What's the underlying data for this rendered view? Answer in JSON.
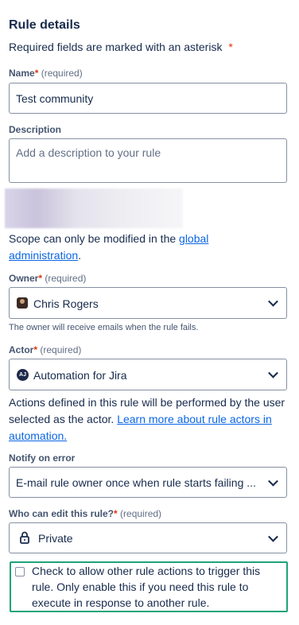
{
  "section": {
    "title": "Rule details",
    "required_note": "Required fields are marked with an asterisk",
    "asterisk": "*"
  },
  "name": {
    "label": "Name",
    "required_hint": "(required)",
    "value": "Test community"
  },
  "description": {
    "label": "Description",
    "placeholder": "Add a description to your rule"
  },
  "scope": {
    "text_before": "Scope can only be modified in the",
    "link": "global administration",
    "text_after": "."
  },
  "owner": {
    "label": "Owner",
    "required_hint": "(required)",
    "value": "Chris Rogers",
    "help": "The owner will receive emails when the rule fails."
  },
  "actor": {
    "label": "Actor",
    "required_hint": "(required)",
    "avatar_initials": "AJ",
    "value": "Automation for Jira",
    "help_text": "Actions defined in this rule will be performed by the user selected as the actor.",
    "help_link": "Learn more about rule actors in automation."
  },
  "notify": {
    "label": "Notify on error",
    "value": "E-mail rule owner once when rule starts failing ..."
  },
  "editors": {
    "label": "Who can edit this rule?",
    "required_hint": "(required)",
    "value": "Private"
  },
  "trigger_checkbox": {
    "text": "Check to allow other rule actions to trigger this rule. Only enable this if you need this rule to execute in response to another rule.",
    "checked": false
  },
  "colors": {
    "link": "#0c66e4",
    "required_star": "#de350b",
    "focus_green": "#1fa37a"
  }
}
